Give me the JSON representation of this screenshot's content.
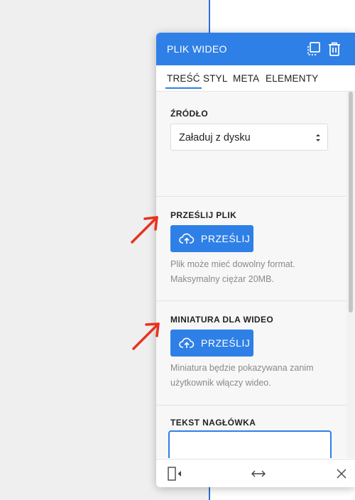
{
  "panel": {
    "title": "PLIK WIDEO",
    "tabs": [
      {
        "label": "TREŚĆ",
        "active": true
      },
      {
        "label": "STYL",
        "active": false
      },
      {
        "label": "META",
        "active": false
      },
      {
        "label": "ELEMENTY",
        "active": false
      }
    ],
    "source": {
      "label": "ŹRÓDŁO",
      "selected": "Załaduj z dysku"
    },
    "upload_file": {
      "label": "PRZEŚLIJ PLIK",
      "button": "PRZEŚLIJ",
      "hint": "Plik może mieć dowolny format. Maksymalny ciężar 20MB."
    },
    "thumbnail": {
      "label": "MINIATURA DLA WIDEO",
      "button": "PRZEŚLIJ",
      "hint": "Miniatura będzie pokazywana zanim użytkownik włączy wideo."
    },
    "heading_text": {
      "label": "TEKST NAGŁÓWKA",
      "value": ""
    }
  },
  "colors": {
    "accent": "#2f80e6",
    "annotation_arrow": "#e8321e"
  },
  "icons": {
    "header": [
      "duplicate-icon",
      "trash-icon"
    ],
    "footer": [
      "dock-panel-icon",
      "resize-horizontal-icon",
      "close-icon"
    ],
    "buttons": "cloud-upload-icon"
  }
}
